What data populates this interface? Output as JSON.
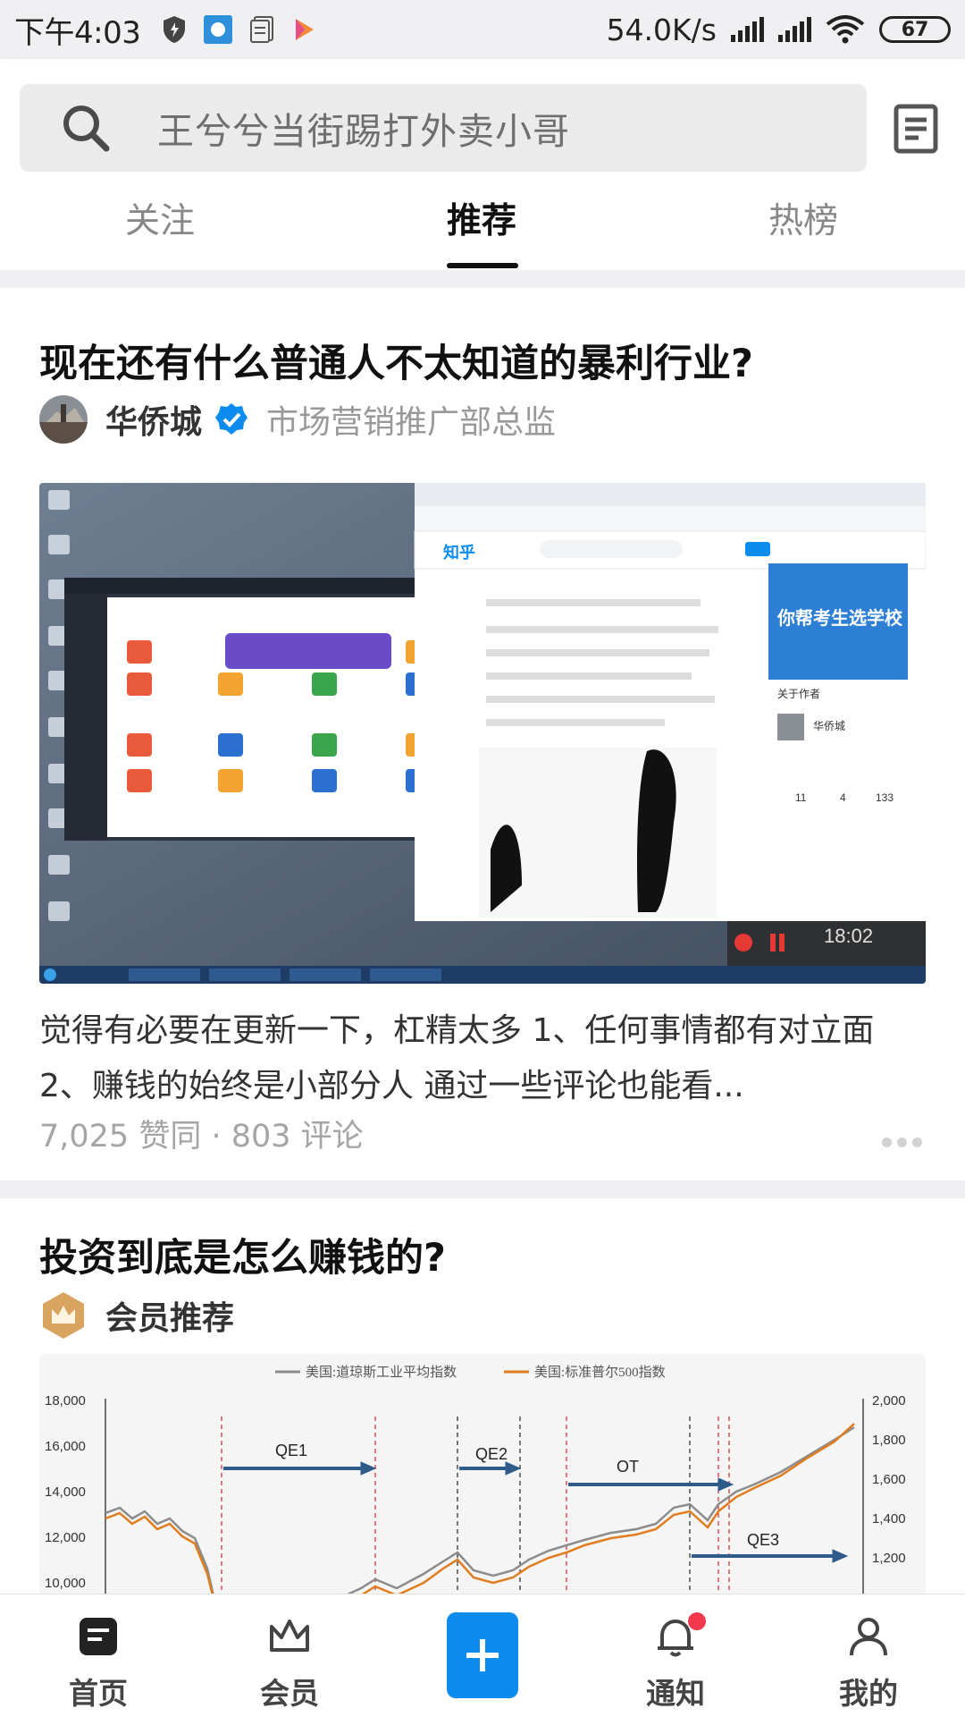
{
  "status_bar": {
    "time": "下午4:03",
    "net_speed": "54.0K/s",
    "battery": "67"
  },
  "search": {
    "placeholder": "王兮兮当街踢打外卖小哥"
  },
  "tabs": [
    {
      "label": "关注"
    },
    {
      "label": "推荐"
    },
    {
      "label": "热榜"
    }
  ],
  "feed": {
    "cards": [
      {
        "title": "现在还有什么普通人不太知道的暴利行业?",
        "author": "华侨城",
        "author_bio": "市场营销推广部总监",
        "excerpt": "觉得有必要在更新一下，杠精太多 1、任何事情都有对立面 2、赚钱的始终是小部分人 通过一些评论也能看...",
        "stats": "7,025 赞同 · 803 评论",
        "image": {
          "logo_text": "知乎",
          "ad_text": "你帮考生选学校",
          "about_author_label": "关于作者",
          "author_name": "华侨城",
          "counts": [
            "11",
            "4",
            "133"
          ],
          "timer": "18:02"
        }
      },
      {
        "title": "投资到底是怎么赚钱的?",
        "author": "会员推荐",
        "image": {
          "legend": [
            "美国:道琼斯工业平均指数",
            "美国:标准普尔500指数"
          ],
          "left_ticks": [
            "18,000",
            "16,000",
            "14,000",
            "12,000",
            "10,000"
          ],
          "right_ticks": [
            "2,000",
            "1,800",
            "1,600",
            "1,400",
            "1,200"
          ],
          "phases": [
            "QE1",
            "QE2",
            "OT",
            "QE3"
          ]
        }
      }
    ]
  },
  "bottom_nav": [
    {
      "label": "首页",
      "icon": "home-icon"
    },
    {
      "label": "会员",
      "icon": "crown-icon"
    },
    {
      "label": "",
      "icon": "plus-icon"
    },
    {
      "label": "通知",
      "icon": "bell-icon"
    },
    {
      "label": "我的",
      "icon": "person-icon"
    }
  ],
  "colors": {
    "accent": "#0d8cf0",
    "notify_dot": "#f3384b",
    "dow_series": "#8c8c8c",
    "sp500_series": "#e07d1f"
  }
}
